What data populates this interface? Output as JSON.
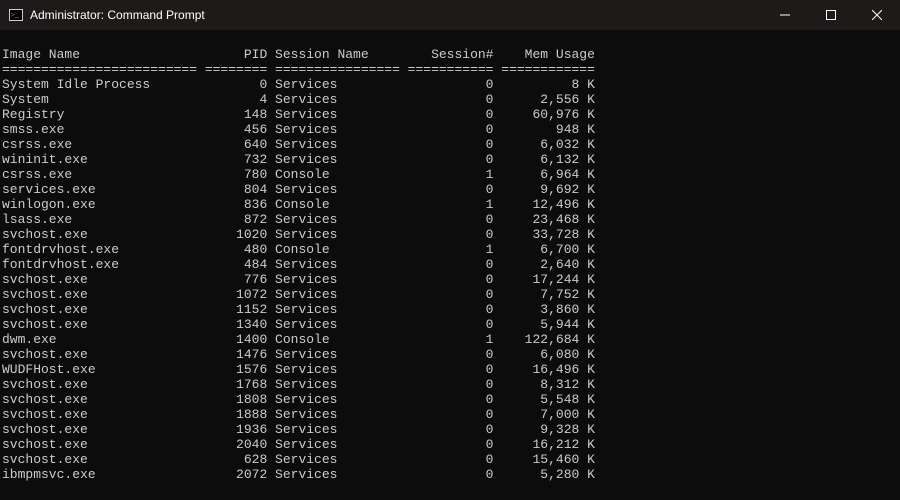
{
  "window": {
    "title": "Administrator: Command Prompt"
  },
  "columns": {
    "image_name": "Image Name",
    "pid": "PID",
    "session_name": "Session Name",
    "session_num": "Session#",
    "mem_usage": "Mem Usage"
  },
  "separator": {
    "image_name": "=========================",
    "pid": "========",
    "session_name": "================",
    "session_num": "===========",
    "mem_usage": "============"
  },
  "processes": [
    {
      "name": "System Idle Process",
      "pid": 0,
      "session": "Services",
      "snum": 0,
      "mem": "8 K"
    },
    {
      "name": "System",
      "pid": 4,
      "session": "Services",
      "snum": 0,
      "mem": "2,556 K"
    },
    {
      "name": "Registry",
      "pid": 148,
      "session": "Services",
      "snum": 0,
      "mem": "60,976 K"
    },
    {
      "name": "smss.exe",
      "pid": 456,
      "session": "Services",
      "snum": 0,
      "mem": "948 K"
    },
    {
      "name": "csrss.exe",
      "pid": 640,
      "session": "Services",
      "snum": 0,
      "mem": "6,032 K"
    },
    {
      "name": "wininit.exe",
      "pid": 732,
      "session": "Services",
      "snum": 0,
      "mem": "6,132 K"
    },
    {
      "name": "csrss.exe",
      "pid": 780,
      "session": "Console",
      "snum": 1,
      "mem": "6,964 K"
    },
    {
      "name": "services.exe",
      "pid": 804,
      "session": "Services",
      "snum": 0,
      "mem": "9,692 K"
    },
    {
      "name": "winlogon.exe",
      "pid": 836,
      "session": "Console",
      "snum": 1,
      "mem": "12,496 K"
    },
    {
      "name": "lsass.exe",
      "pid": 872,
      "session": "Services",
      "snum": 0,
      "mem": "23,468 K"
    },
    {
      "name": "svchost.exe",
      "pid": 1020,
      "session": "Services",
      "snum": 0,
      "mem": "33,728 K"
    },
    {
      "name": "fontdrvhost.exe",
      "pid": 480,
      "session": "Console",
      "snum": 1,
      "mem": "6,700 K"
    },
    {
      "name": "fontdrvhost.exe",
      "pid": 484,
      "session": "Services",
      "snum": 0,
      "mem": "2,640 K"
    },
    {
      "name": "svchost.exe",
      "pid": 776,
      "session": "Services",
      "snum": 0,
      "mem": "17,244 K"
    },
    {
      "name": "svchost.exe",
      "pid": 1072,
      "session": "Services",
      "snum": 0,
      "mem": "7,752 K"
    },
    {
      "name": "svchost.exe",
      "pid": 1152,
      "session": "Services",
      "snum": 0,
      "mem": "3,860 K"
    },
    {
      "name": "svchost.exe",
      "pid": 1340,
      "session": "Services",
      "snum": 0,
      "mem": "5,944 K"
    },
    {
      "name": "dwm.exe",
      "pid": 1400,
      "session": "Console",
      "snum": 1,
      "mem": "122,684 K"
    },
    {
      "name": "svchost.exe",
      "pid": 1476,
      "session": "Services",
      "snum": 0,
      "mem": "6,080 K"
    },
    {
      "name": "WUDFHost.exe",
      "pid": 1576,
      "session": "Services",
      "snum": 0,
      "mem": "16,496 K"
    },
    {
      "name": "svchost.exe",
      "pid": 1768,
      "session": "Services",
      "snum": 0,
      "mem": "8,312 K"
    },
    {
      "name": "svchost.exe",
      "pid": 1808,
      "session": "Services",
      "snum": 0,
      "mem": "5,548 K"
    },
    {
      "name": "svchost.exe",
      "pid": 1888,
      "session": "Services",
      "snum": 0,
      "mem": "7,000 K"
    },
    {
      "name": "svchost.exe",
      "pid": 1936,
      "session": "Services",
      "snum": 0,
      "mem": "9,328 K"
    },
    {
      "name": "svchost.exe",
      "pid": 2040,
      "session": "Services",
      "snum": 0,
      "mem": "16,212 K"
    },
    {
      "name": "svchost.exe",
      "pid": 628,
      "session": "Services",
      "snum": 0,
      "mem": "15,460 K"
    },
    {
      "name": "ibmpmsvc.exe",
      "pid": 2072,
      "session": "Services",
      "snum": 0,
      "mem": "5,280 K"
    }
  ]
}
